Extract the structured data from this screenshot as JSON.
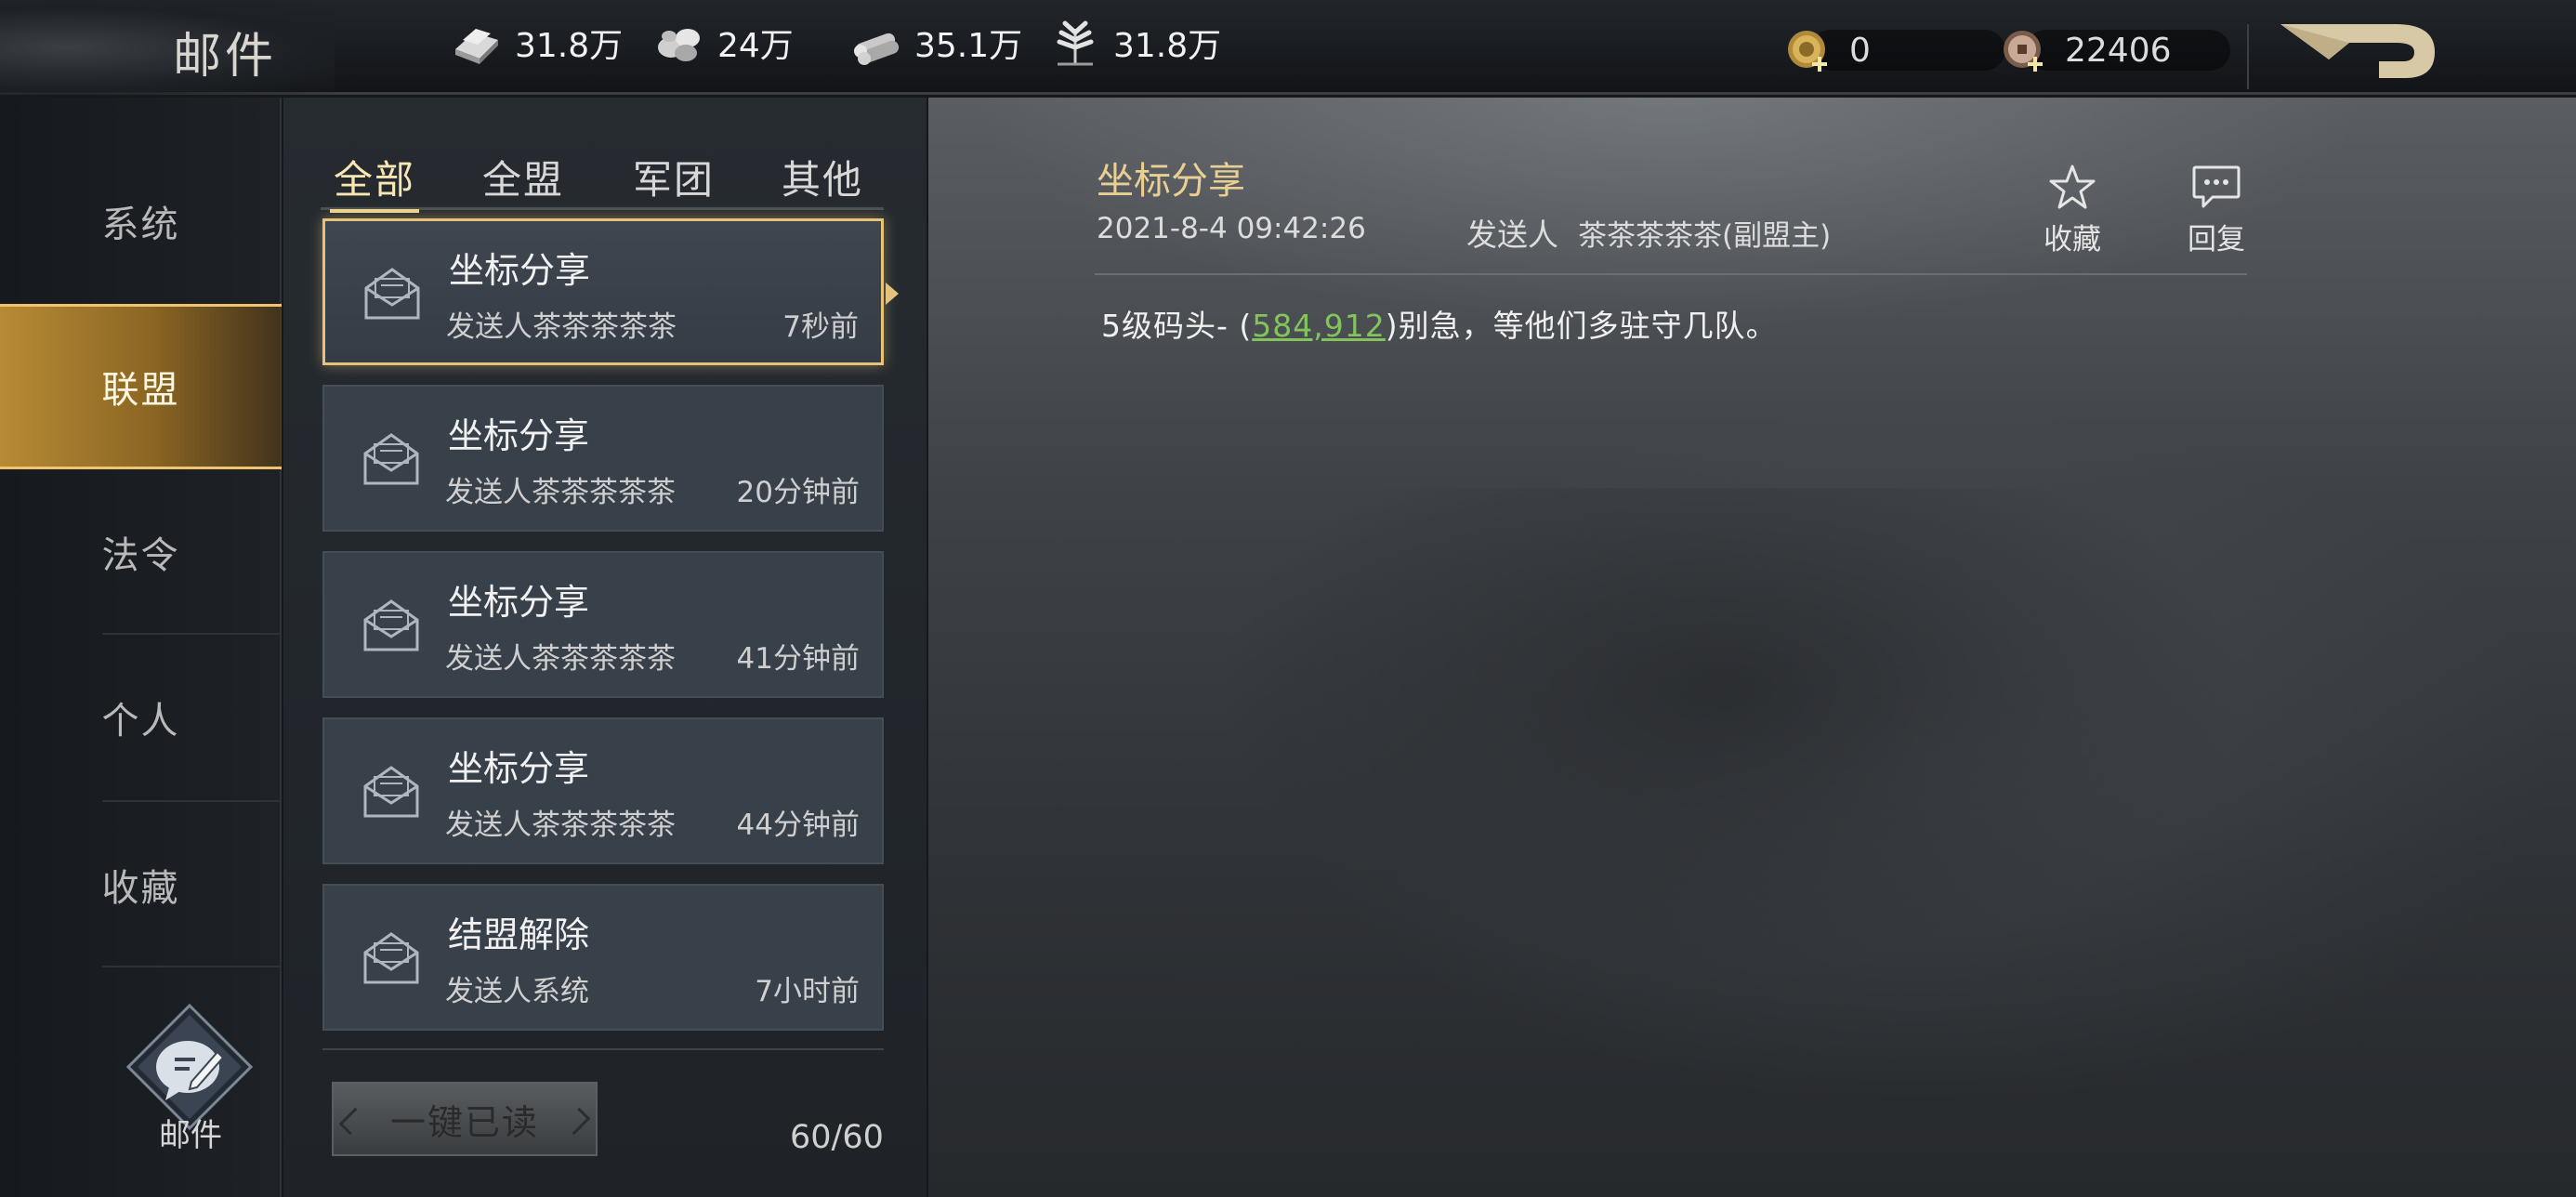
{
  "header": {
    "title": "邮件",
    "resources": [
      {
        "icon": "iron-icon",
        "value": "31.8万"
      },
      {
        "icon": "stone-icon",
        "value": "24万"
      },
      {
        "icon": "wood-icon",
        "value": "35.1万"
      },
      {
        "icon": "grain-icon",
        "value": "31.8万"
      }
    ],
    "gold": {
      "icon": "gold-coin-icon",
      "value": "0"
    },
    "copper": {
      "icon": "copper-coin-icon",
      "value": "22406"
    }
  },
  "sidebar": {
    "items": [
      {
        "label": "系统"
      },
      {
        "label": "联盟"
      },
      {
        "label": "法令"
      },
      {
        "label": "个人"
      },
      {
        "label": "收藏"
      }
    ],
    "active_index": 1,
    "compose_label": "邮件"
  },
  "mail_list": {
    "tabs": [
      "全部",
      "全盟",
      "军团",
      "其他"
    ],
    "active_tab": 0,
    "items": [
      {
        "title": "坐标分享",
        "sender": "发送人茶茶茶茶茶",
        "time": "7秒前"
      },
      {
        "title": "坐标分享",
        "sender": "发送人茶茶茶茶茶",
        "time": "20分钟前"
      },
      {
        "title": "坐标分享",
        "sender": "发送人茶茶茶茶茶",
        "time": "41分钟前"
      },
      {
        "title": "坐标分享",
        "sender": "发送人茶茶茶茶茶",
        "time": "44分钟前"
      },
      {
        "title": "结盟解除",
        "sender": "发送人系统",
        "time": "7小时前"
      }
    ],
    "selected_index": 0,
    "read_all_label": "一键已读",
    "count": "60/60"
  },
  "detail": {
    "title": "坐标分享",
    "date": "2021-8-4 09:42:26",
    "sender_label": "发送人",
    "sender": "茶茶茶茶茶(副盟主)",
    "favorite_label": "收藏",
    "reply_label": "回复",
    "body_prefix": "5级码头- (",
    "body_coord": "584,912",
    "body_suffix": ")别急，等他们多驻守几队。"
  },
  "colors": {
    "accent_gold": "#e7c37a",
    "coord_link": "#82c45b",
    "detail_title": "#e9cf92"
  }
}
